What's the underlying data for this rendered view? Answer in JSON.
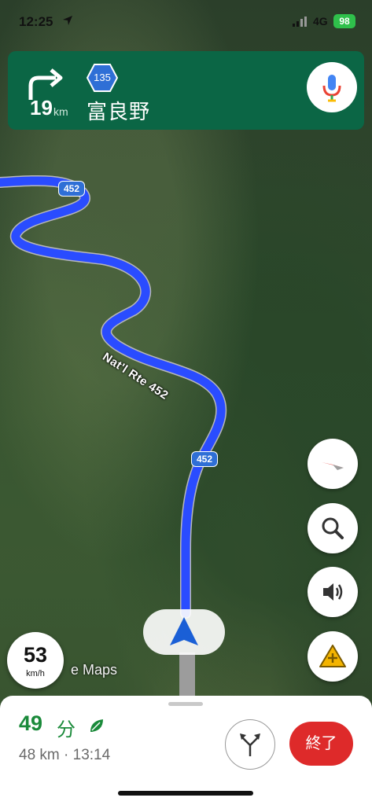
{
  "status_bar": {
    "time": "12:25",
    "network": "4G",
    "battery": "98"
  },
  "nav": {
    "turn_icon": "turn-right-icon",
    "distance_value": "19",
    "distance_unit": "km",
    "route_shield": "135",
    "destination": "富良野"
  },
  "map": {
    "road_name": "Nat'l Rte 452",
    "shield_top": "452",
    "shield_bottom": "452",
    "watermark": "e Maps"
  },
  "controls": {
    "compass_icon": "compass-icon",
    "search_icon": "search-icon",
    "sound_icon": "speaker-icon",
    "report_icon": "report-incident-icon"
  },
  "speed": {
    "value": "53",
    "unit": "km/h"
  },
  "trip": {
    "eta_minutes": "49",
    "eta_unit": "分",
    "distance_time": "48 km · 13:14",
    "end_label": "終了"
  },
  "colors": {
    "nav_card": "#0b6645",
    "route_line": "#2a4cff",
    "end_button": "#de2a2a",
    "eta_text": "#1a8a3a"
  }
}
